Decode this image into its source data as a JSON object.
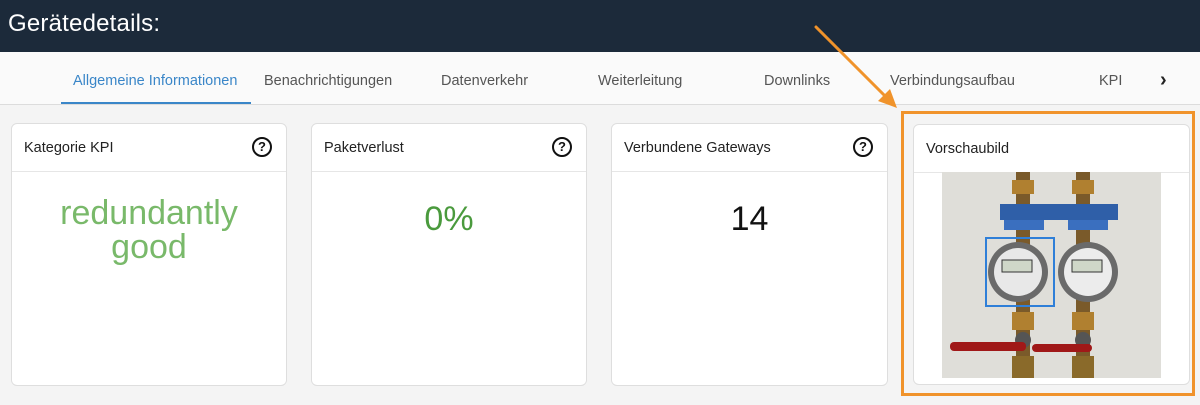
{
  "header": {
    "title": "Gerätedetails:"
  },
  "tabs": [
    {
      "label": "Allgemeine Informationen",
      "active": true
    },
    {
      "label": "Benachrichtigungen",
      "active": false
    },
    {
      "label": "Datenverkehr",
      "active": false
    },
    {
      "label": "Weiterleitung",
      "active": false
    },
    {
      "label": "Downlinks",
      "active": false
    },
    {
      "label": "Verbindungsaufbau",
      "active": false
    },
    {
      "label": "KPI",
      "active": false
    }
  ],
  "tab_next_icon": "›",
  "cards": {
    "kpi_category": {
      "title": "Kategorie KPI",
      "value_line1": "redundantly",
      "value_line2": "good",
      "help": "?"
    },
    "packet_loss": {
      "title": "Paketverlust",
      "value": "0%",
      "help": "?"
    },
    "gateways": {
      "title": "Verbundene Gateways",
      "value": "14",
      "help": "?"
    },
    "preview": {
      "title": "Vorschaubild"
    }
  },
  "colors": {
    "header_bg": "#1c2a3a",
    "accent_blue": "#3a86c8",
    "kpi_green": "#79b96a",
    "loss_green": "#4a9a3d",
    "highlight_orange": "#f0932b"
  }
}
